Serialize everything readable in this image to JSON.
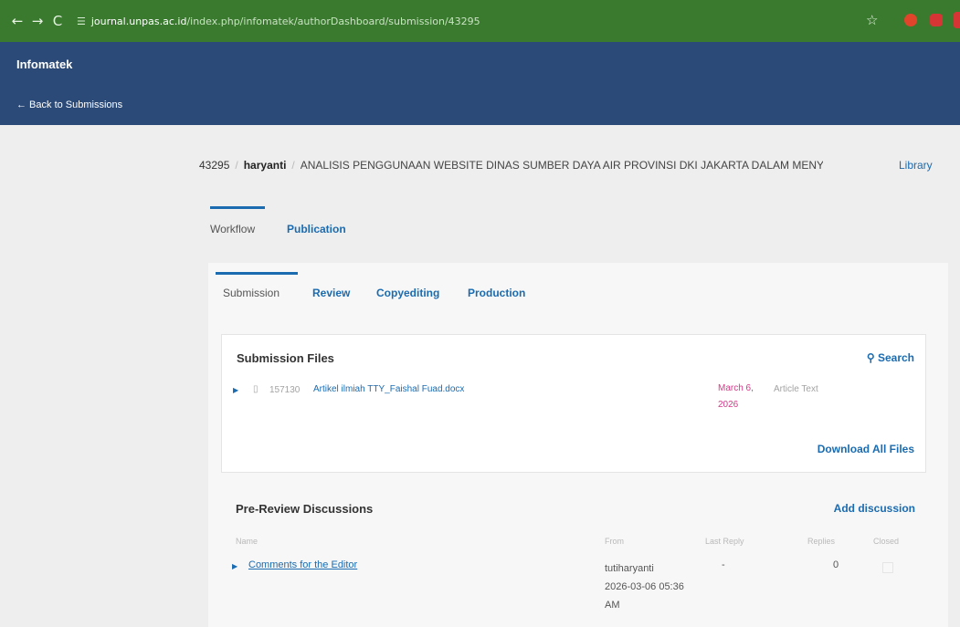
{
  "browser": {
    "url_host": "journal.unpas.ac.id",
    "url_path": "/index.php/infomatek/authorDashboard/submission/43295"
  },
  "header": {
    "journal_name": "Infomatek",
    "back_label": "← Back to Submissions"
  },
  "breadcrumb": {
    "id": "43295",
    "author": "haryanti",
    "title": "ANALISIS PENGGUNAAN WEBSITE DINAS SUMBER DAYA AIR PROVINSI DKI JAKARTA DALAM MENYAMPAIKAN INFORMASI",
    "library_label": "Library"
  },
  "main_tabs": [
    {
      "label": "Workflow",
      "active": true
    },
    {
      "label": "Publication",
      "active": false
    }
  ],
  "stage_tabs": [
    {
      "label": "Submission",
      "active": true
    },
    {
      "label": "Review",
      "active": false
    },
    {
      "label": "Copyediting",
      "active": false
    },
    {
      "label": "Production",
      "active": false
    }
  ],
  "submission_files": {
    "title": "Submission Files",
    "search_label": "Search",
    "download_all_label": "Download All Files",
    "files": [
      {
        "id": "157130",
        "name": "Artikel ilmiah TTY_Faishal Fuad.docx",
        "date_line1": "March 6,",
        "date_line2": "2026",
        "type": "Article Text"
      }
    ]
  },
  "discussions": {
    "title": "Pre-Review Discussions",
    "add_label": "Add discussion",
    "columns": {
      "name": "Name",
      "from": "From",
      "last_reply": "Last Reply",
      "replies": "Replies",
      "closed": "Closed"
    },
    "rows": [
      {
        "name": "Comments for the Editor",
        "from_user": "tutiharyanti",
        "from_date": "2026-03-06 05:36",
        "from_time_suffix": "AM",
        "last_reply": "-",
        "replies": "0"
      }
    ]
  },
  "colors": {
    "browser_bar": "#3a7a2e",
    "journal_bar": "#2b4a78",
    "link": "#1a6bb0",
    "date_highlight": "#d23b87"
  }
}
